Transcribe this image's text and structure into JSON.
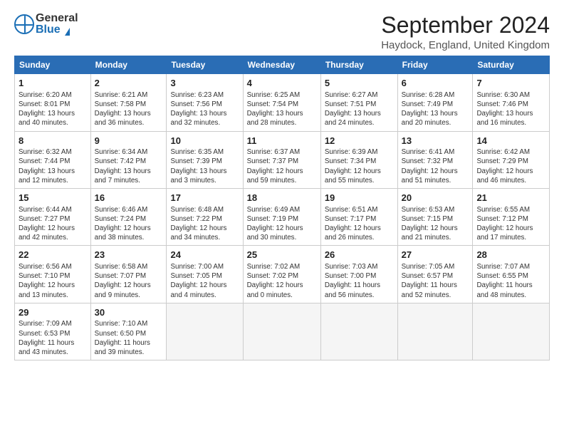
{
  "header": {
    "logo_general": "General",
    "logo_blue": "Blue",
    "title": "September 2024",
    "subtitle": "Haydock, England, United Kingdom"
  },
  "calendar": {
    "days_of_week": [
      "Sunday",
      "Monday",
      "Tuesday",
      "Wednesday",
      "Thursday",
      "Friday",
      "Saturday"
    ],
    "weeks": [
      [
        {
          "day": "1",
          "detail": "Sunrise: 6:20 AM\nSunset: 8:01 PM\nDaylight: 13 hours\nand 40 minutes."
        },
        {
          "day": "2",
          "detail": "Sunrise: 6:21 AM\nSunset: 7:58 PM\nDaylight: 13 hours\nand 36 minutes."
        },
        {
          "day": "3",
          "detail": "Sunrise: 6:23 AM\nSunset: 7:56 PM\nDaylight: 13 hours\nand 32 minutes."
        },
        {
          "day": "4",
          "detail": "Sunrise: 6:25 AM\nSunset: 7:54 PM\nDaylight: 13 hours\nand 28 minutes."
        },
        {
          "day": "5",
          "detail": "Sunrise: 6:27 AM\nSunset: 7:51 PM\nDaylight: 13 hours\nand 24 minutes."
        },
        {
          "day": "6",
          "detail": "Sunrise: 6:28 AM\nSunset: 7:49 PM\nDaylight: 13 hours\nand 20 minutes."
        },
        {
          "day": "7",
          "detail": "Sunrise: 6:30 AM\nSunset: 7:46 PM\nDaylight: 13 hours\nand 16 minutes."
        }
      ],
      [
        {
          "day": "8",
          "detail": "Sunrise: 6:32 AM\nSunset: 7:44 PM\nDaylight: 13 hours\nand 12 minutes."
        },
        {
          "day": "9",
          "detail": "Sunrise: 6:34 AM\nSunset: 7:42 PM\nDaylight: 13 hours\nand 7 minutes."
        },
        {
          "day": "10",
          "detail": "Sunrise: 6:35 AM\nSunset: 7:39 PM\nDaylight: 13 hours\nand 3 minutes."
        },
        {
          "day": "11",
          "detail": "Sunrise: 6:37 AM\nSunset: 7:37 PM\nDaylight: 12 hours\nand 59 minutes."
        },
        {
          "day": "12",
          "detail": "Sunrise: 6:39 AM\nSunset: 7:34 PM\nDaylight: 12 hours\nand 55 minutes."
        },
        {
          "day": "13",
          "detail": "Sunrise: 6:41 AM\nSunset: 7:32 PM\nDaylight: 12 hours\nand 51 minutes."
        },
        {
          "day": "14",
          "detail": "Sunrise: 6:42 AM\nSunset: 7:29 PM\nDaylight: 12 hours\nand 46 minutes."
        }
      ],
      [
        {
          "day": "15",
          "detail": "Sunrise: 6:44 AM\nSunset: 7:27 PM\nDaylight: 12 hours\nand 42 minutes."
        },
        {
          "day": "16",
          "detail": "Sunrise: 6:46 AM\nSunset: 7:24 PM\nDaylight: 12 hours\nand 38 minutes."
        },
        {
          "day": "17",
          "detail": "Sunrise: 6:48 AM\nSunset: 7:22 PM\nDaylight: 12 hours\nand 34 minutes."
        },
        {
          "day": "18",
          "detail": "Sunrise: 6:49 AM\nSunset: 7:19 PM\nDaylight: 12 hours\nand 30 minutes."
        },
        {
          "day": "19",
          "detail": "Sunrise: 6:51 AM\nSunset: 7:17 PM\nDaylight: 12 hours\nand 26 minutes."
        },
        {
          "day": "20",
          "detail": "Sunrise: 6:53 AM\nSunset: 7:15 PM\nDaylight: 12 hours\nand 21 minutes."
        },
        {
          "day": "21",
          "detail": "Sunrise: 6:55 AM\nSunset: 7:12 PM\nDaylight: 12 hours\nand 17 minutes."
        }
      ],
      [
        {
          "day": "22",
          "detail": "Sunrise: 6:56 AM\nSunset: 7:10 PM\nDaylight: 12 hours\nand 13 minutes."
        },
        {
          "day": "23",
          "detail": "Sunrise: 6:58 AM\nSunset: 7:07 PM\nDaylight: 12 hours\nand 9 minutes."
        },
        {
          "day": "24",
          "detail": "Sunrise: 7:00 AM\nSunset: 7:05 PM\nDaylight: 12 hours\nand 4 minutes."
        },
        {
          "day": "25",
          "detail": "Sunrise: 7:02 AM\nSunset: 7:02 PM\nDaylight: 12 hours\nand 0 minutes."
        },
        {
          "day": "26",
          "detail": "Sunrise: 7:03 AM\nSunset: 7:00 PM\nDaylight: 11 hours\nand 56 minutes."
        },
        {
          "day": "27",
          "detail": "Sunrise: 7:05 AM\nSunset: 6:57 PM\nDaylight: 11 hours\nand 52 minutes."
        },
        {
          "day": "28",
          "detail": "Sunrise: 7:07 AM\nSunset: 6:55 PM\nDaylight: 11 hours\nand 48 minutes."
        }
      ],
      [
        {
          "day": "29",
          "detail": "Sunrise: 7:09 AM\nSunset: 6:53 PM\nDaylight: 11 hours\nand 43 minutes."
        },
        {
          "day": "30",
          "detail": "Sunrise: 7:10 AM\nSunset: 6:50 PM\nDaylight: 11 hours\nand 39 minutes."
        },
        {
          "day": "",
          "detail": ""
        },
        {
          "day": "",
          "detail": ""
        },
        {
          "day": "",
          "detail": ""
        },
        {
          "day": "",
          "detail": ""
        },
        {
          "day": "",
          "detail": ""
        }
      ]
    ]
  }
}
